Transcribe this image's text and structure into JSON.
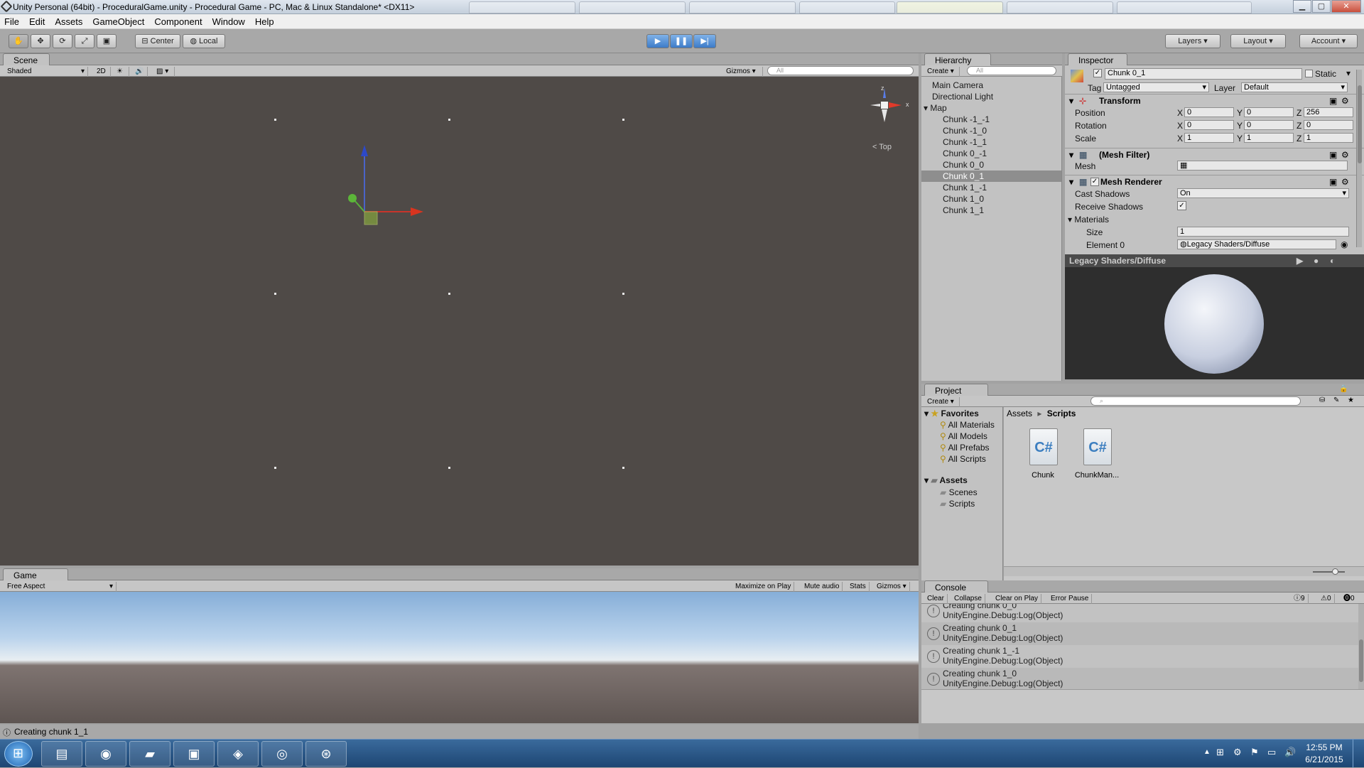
{
  "window": {
    "title": "Unity Personal (64bit) - ProceduralGame.unity - Procedural Game - PC, Mac & Linux Standalone* <DX11>",
    "min": "▁",
    "max": "▢",
    "close": "✕"
  },
  "menu": [
    "File",
    "Edit",
    "Assets",
    "GameObject",
    "Component",
    "Window",
    "Help"
  ],
  "toolbar": {
    "pivot": "Center",
    "space": "Local",
    "layers": "Layers",
    "layout": "Layout",
    "account": "Account"
  },
  "scene": {
    "tab": "Scene",
    "shading": "Shaded",
    "mode2d": "2D",
    "gizmos": "Gizmos",
    "search_placeholder": "All",
    "gizmo_label": "Top",
    "axis_z": "z",
    "axis_x": "x"
  },
  "hierarchy": {
    "tab": "Hierarchy",
    "create": "Create",
    "search_placeholder": "All",
    "items": [
      {
        "label": "Main Camera",
        "indent": 0
      },
      {
        "label": "Directional Light",
        "indent": 0
      },
      {
        "label": "Map",
        "indent": 0
      },
      {
        "label": "Chunk -1_-1",
        "indent": 1
      },
      {
        "label": "Chunk -1_0",
        "indent": 1
      },
      {
        "label": "Chunk -1_1",
        "indent": 1
      },
      {
        "label": "Chunk 0_-1",
        "indent": 1
      },
      {
        "label": "Chunk 0_0",
        "indent": 1
      },
      {
        "label": "Chunk 0_1",
        "indent": 1
      },
      {
        "label": "Chunk 1_-1",
        "indent": 1
      },
      {
        "label": "Chunk 1_0",
        "indent": 1
      },
      {
        "label": "Chunk 1_1",
        "indent": 1
      }
    ],
    "selected": "Chunk 0_1"
  },
  "inspector": {
    "tab": "Inspector",
    "object_name": "Chunk 0_1",
    "static_label": "Static",
    "tag_label": "Tag",
    "tag_value": "Untagged",
    "layer_label": "Layer",
    "layer_value": "Default",
    "transform": {
      "title": "Transform",
      "position": {
        "label": "Position",
        "x": "0",
        "y": "0",
        "z": "256"
      },
      "rotation": {
        "label": "Rotation",
        "x": "0",
        "y": "0",
        "z": "0"
      },
      "scale": {
        "label": "Scale",
        "x": "1",
        "y": "1",
        "z": "1"
      }
    },
    "mesh_filter": {
      "title": "(Mesh Filter)",
      "mesh_label": "Mesh"
    },
    "mesh_renderer": {
      "title": "Mesh Renderer",
      "cast_label": "Cast Shadows",
      "cast_value": "On",
      "receive_label": "Receive Shadows",
      "materials_label": "Materials",
      "size_label": "Size",
      "size_value": "1",
      "element_label": "Element 0",
      "element_value": "Legacy Shaders/Diffuse"
    },
    "preview_title": "Legacy Shaders/Diffuse"
  },
  "project": {
    "tab": "Project",
    "create": "Create",
    "favorites_label": "Favorites",
    "favorites": [
      "All Materials",
      "All Models",
      "All Prefabs",
      "All Scripts"
    ],
    "assets_label": "Assets",
    "folders": [
      "Scenes",
      "Scripts"
    ],
    "breadcrumb": [
      "Assets",
      "Scripts"
    ],
    "files": [
      {
        "name": "Chunk",
        "glyph": "C#"
      },
      {
        "name": "ChunkMan...",
        "glyph": "C#"
      }
    ]
  },
  "game": {
    "tab": "Game",
    "aspect": "Free Aspect",
    "maximize": "Maximize on Play",
    "mute": "Mute audio",
    "stats": "Stats",
    "gizmos": "Gizmos"
  },
  "console": {
    "tab": "Console",
    "clear": "Clear",
    "collapse": "Collapse",
    "clear_on_play": "Clear on Play",
    "error_pause": "Error Pause",
    "count_log": "9",
    "count_warn": "0",
    "count_err": "0",
    "entries": [
      {
        "line1": "Creating chunk 0_0",
        "line2": "UnityEngine.Debug:Log(Object)"
      },
      {
        "line1": "Creating chunk 0_1",
        "line2": "UnityEngine.Debug:Log(Object)"
      },
      {
        "line1": "Creating chunk 1_-1",
        "line2": "UnityEngine.Debug:Log(Object)"
      },
      {
        "line1": "Creating chunk 1_0",
        "line2": "UnityEngine.Debug:Log(Object)"
      }
    ]
  },
  "statusbar": {
    "text": "Creating chunk 1_1"
  },
  "taskbar": {
    "time": "12:55 PM",
    "date": "6/21/2015",
    "apps": [
      "explorer-icon",
      "chrome-icon",
      "folder-icon",
      "terminal-icon",
      "unity-icon",
      "monodevelop-icon",
      "steam-icon"
    ]
  }
}
